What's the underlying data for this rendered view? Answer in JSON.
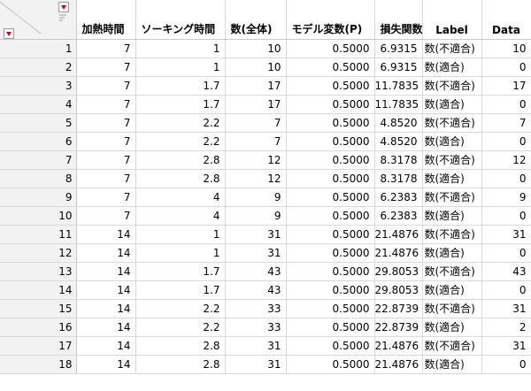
{
  "columns": [
    "加熱時間",
    "ソーキング時間",
    "数(全体)",
    "モデル変数(P)",
    "損失関数",
    "Label",
    "Data"
  ],
  "rows": [
    {
      "n": "1",
      "c1": "7",
      "c2": "1",
      "c3": "10",
      "c4": "0.5000",
      "c5": "6.9315",
      "c6": "数(不適合)",
      "c7": "10"
    },
    {
      "n": "2",
      "c1": "7",
      "c2": "1",
      "c3": "10",
      "c4": "0.5000",
      "c5": "6.9315",
      "c6": "数(適合)",
      "c7": "0"
    },
    {
      "n": "3",
      "c1": "7",
      "c2": "1.7",
      "c3": "17",
      "c4": "0.5000",
      "c5": "11.7835",
      "c6": "数(不適合)",
      "c7": "17"
    },
    {
      "n": "4",
      "c1": "7",
      "c2": "1.7",
      "c3": "17",
      "c4": "0.5000",
      "c5": "11.7835",
      "c6": "数(適合)",
      "c7": "0"
    },
    {
      "n": "5",
      "c1": "7",
      "c2": "2.2",
      "c3": "7",
      "c4": "0.5000",
      "c5": "4.8520",
      "c6": "数(不適合)",
      "c7": "7"
    },
    {
      "n": "6",
      "c1": "7",
      "c2": "2.2",
      "c3": "7",
      "c4": "0.5000",
      "c5": "4.8520",
      "c6": "数(適合)",
      "c7": "0"
    },
    {
      "n": "7",
      "c1": "7",
      "c2": "2.8",
      "c3": "12",
      "c4": "0.5000",
      "c5": "8.3178",
      "c6": "数(不適合)",
      "c7": "12"
    },
    {
      "n": "8",
      "c1": "7",
      "c2": "2.8",
      "c3": "12",
      "c4": "0.5000",
      "c5": "8.3178",
      "c6": "数(適合)",
      "c7": "0"
    },
    {
      "n": "9",
      "c1": "7",
      "c2": "4",
      "c3": "9",
      "c4": "0.5000",
      "c5": "6.2383",
      "c6": "数(不適合)",
      "c7": "9"
    },
    {
      "n": "10",
      "c1": "7",
      "c2": "4",
      "c3": "9",
      "c4": "0.5000",
      "c5": "6.2383",
      "c6": "数(適合)",
      "c7": "0"
    },
    {
      "n": "11",
      "c1": "14",
      "c2": "1",
      "c3": "31",
      "c4": "0.5000",
      "c5": "21.4876",
      "c6": "数(不適合)",
      "c7": "31"
    },
    {
      "n": "12",
      "c1": "14",
      "c2": "1",
      "c3": "31",
      "c4": "0.5000",
      "c5": "21.4876",
      "c6": "数(適合)",
      "c7": "0"
    },
    {
      "n": "13",
      "c1": "14",
      "c2": "1.7",
      "c3": "43",
      "c4": "0.5000",
      "c5": "29.8053",
      "c6": "数(不適合)",
      "c7": "43"
    },
    {
      "n": "14",
      "c1": "14",
      "c2": "1.7",
      "c3": "43",
      "c4": "0.5000",
      "c5": "29.8053",
      "c6": "数(適合)",
      "c7": "0"
    },
    {
      "n": "15",
      "c1": "14",
      "c2": "2.2",
      "c3": "33",
      "c4": "0.5000",
      "c5": "22.8739",
      "c6": "数(不適合)",
      "c7": "31"
    },
    {
      "n": "16",
      "c1": "14",
      "c2": "2.2",
      "c3": "33",
      "c4": "0.5000",
      "c5": "22.8739",
      "c6": "数(適合)",
      "c7": "2"
    },
    {
      "n": "17",
      "c1": "14",
      "c2": "2.8",
      "c3": "31",
      "c4": "0.5000",
      "c5": "21.4876",
      "c6": "数(不適合)",
      "c7": "31"
    },
    {
      "n": "18",
      "c1": "14",
      "c2": "2.8",
      "c3": "31",
      "c4": "0.5000",
      "c5": "21.4876",
      "c6": "数(適合)",
      "c7": "0"
    }
  ]
}
